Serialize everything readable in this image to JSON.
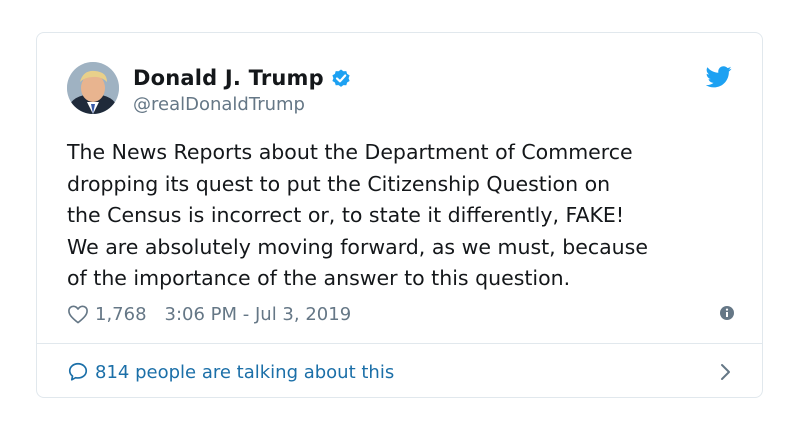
{
  "author": {
    "display_name": "Donald J. Trump",
    "handle": "@realDonaldTrump",
    "verified": true
  },
  "tweet": {
    "text": "The News Reports about the Department of Commerce\ndropping its quest to put the Citizenship Question on\nthe Census is incorrect or, to state it differently, FAKE!\nWe are absolutely moving forward, as we must, because\nof the importance of the answer to this question.",
    "like_count": "1,768",
    "timestamp": "3:06 PM - Jul 3, 2019"
  },
  "footer": {
    "talking_text": "814 people are talking about this"
  },
  "icons": {
    "brand": "twitter-bird-icon",
    "verified": "verified-badge-icon",
    "like": "heart-icon",
    "info": "info-icon",
    "conversation": "speech-bubble-icon",
    "chevron": "chevron-right-icon"
  },
  "colors": {
    "brand_blue": "#1da1f2",
    "link_blue": "#1b6fa8",
    "secondary_text": "#657786",
    "primary_text": "#14171a",
    "border": "#e1e8ed"
  }
}
